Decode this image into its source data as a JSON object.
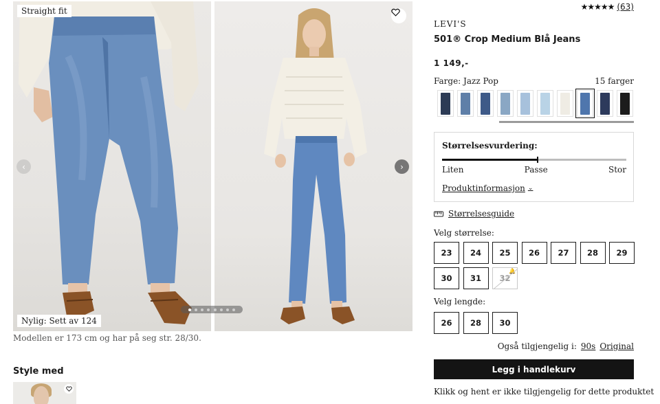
{
  "gallery": {
    "fit_badge": "Straight fit",
    "recent_badge": "Nylig: Sett av 124",
    "model_note": "Modellen er 173 cm og har på seg str. 28/30.",
    "dots_total": 8,
    "dots_active_index": 0
  },
  "style_with": {
    "title": "Style med"
  },
  "product": {
    "rating_stars": "★★★★★",
    "rating_count": "(63)",
    "brand": "LEVI'S",
    "name": "501® Crop Medium Blå Jeans",
    "price": "1 149,-",
    "color_label": "Farge: Jazz Pop",
    "color_count": "15 farger",
    "swatches": [
      {
        "color": "#2c3b55",
        "selected": false
      },
      {
        "color": "#5f7fa8",
        "selected": false
      },
      {
        "color": "#3e5a88",
        "selected": false
      },
      {
        "color": "#8aa7c4",
        "selected": false
      },
      {
        "color": "#a7c1dc",
        "selected": false
      },
      {
        "color": "#b9d3e6",
        "selected": false
      },
      {
        "color": "#efece4",
        "selected": false
      },
      {
        "color": "#4f76ad",
        "selected": true
      },
      {
        "color": "#2d3a5c",
        "selected": false
      },
      {
        "color": "#1c1c1c",
        "selected": false
      }
    ]
  },
  "size_rating": {
    "title": "Størrelsesvurdering:",
    "value": 0.515,
    "low": "Liten",
    "mid": "Passe",
    "high": "Stor",
    "info_link": "Produktinformasjon"
  },
  "size_guide": {
    "label": "Størrelsesguide"
  },
  "sizes": {
    "label": "Velg størrelse:",
    "options": [
      "23",
      "24",
      "25",
      "26",
      "27",
      "28",
      "29",
      "30",
      "31",
      "32"
    ],
    "unavailable": [
      "32"
    ]
  },
  "lengths": {
    "label": "Velg lengde:",
    "options": [
      "26",
      "28",
      "30"
    ]
  },
  "also_available": {
    "label": "Også tilgjengelig i:",
    "options": [
      "90s",
      "Original"
    ]
  },
  "cart": {
    "add_label": "Legg i handlekurv",
    "click_collect": "Klikk og hent er ikke tilgjengelig for dette produktet"
  }
}
